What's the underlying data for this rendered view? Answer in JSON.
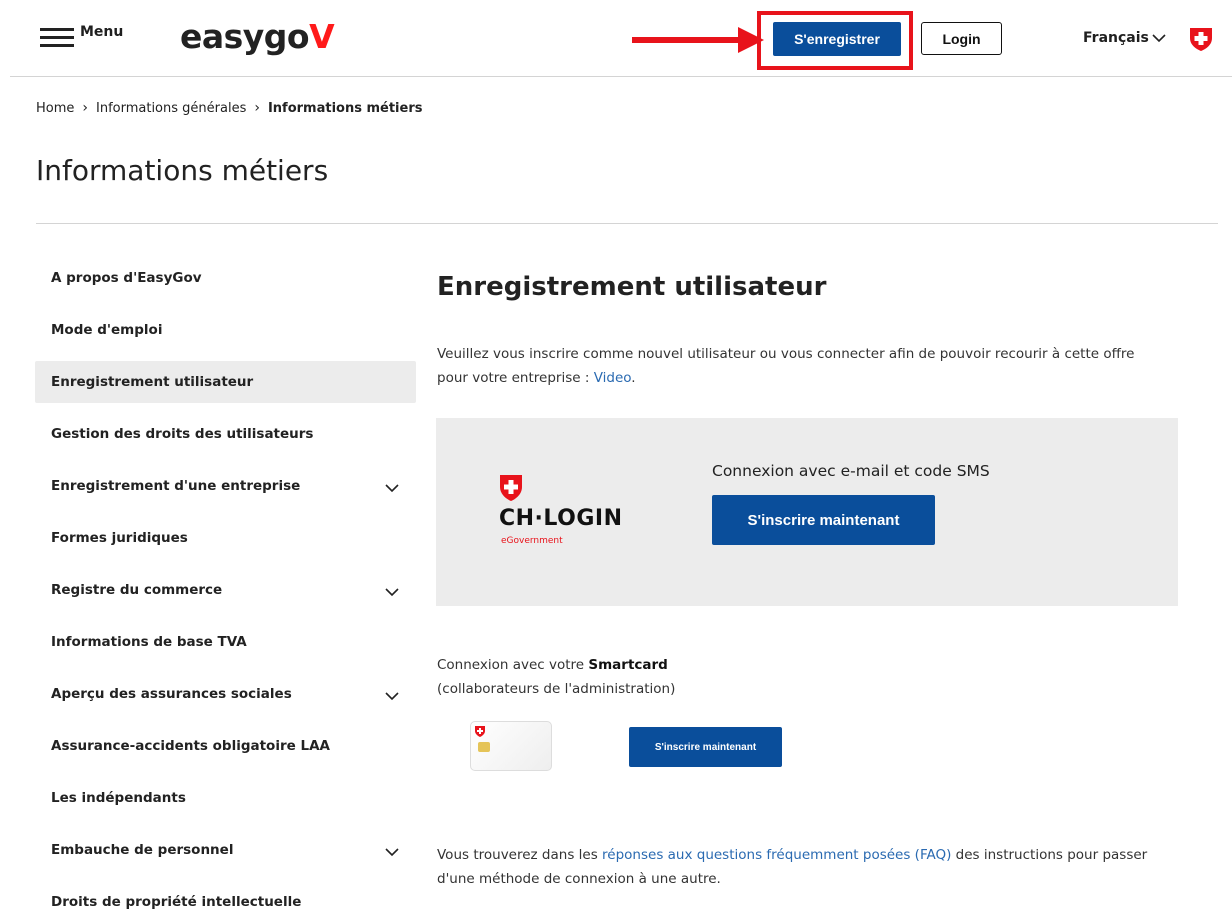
{
  "header": {
    "menu_label": "Menu",
    "logo_text": "easygo",
    "logo_accent": "V",
    "register_label": "S'enregistrer",
    "login_label": "Login",
    "language": "Français"
  },
  "breadcrumb": {
    "items": [
      "Home",
      "Informations générales",
      "Informations métiers"
    ]
  },
  "page_title": "Informations métiers",
  "sidebar": {
    "items": [
      {
        "label": "A propos d'EasyGov",
        "expandable": false,
        "active": false
      },
      {
        "label": "Mode d'emploi",
        "expandable": false,
        "active": false
      },
      {
        "label": "Enregistrement utilisateur",
        "expandable": false,
        "active": true
      },
      {
        "label": "Gestion des droits des utilisateurs",
        "expandable": false,
        "active": false
      },
      {
        "label": "Enregistrement d'une entreprise",
        "expandable": true,
        "active": false
      },
      {
        "label": "Formes juridiques",
        "expandable": false,
        "active": false
      },
      {
        "label": "Registre du commerce",
        "expandable": true,
        "active": false
      },
      {
        "label": "Informations de base TVA",
        "expandable": false,
        "active": false
      },
      {
        "label": "Aperçu des assurances sociales",
        "expandable": true,
        "active": false
      },
      {
        "label": "Assurance-accidents obligatoire LAA",
        "expandable": false,
        "active": false
      },
      {
        "label": "Les indépendants",
        "expandable": false,
        "active": false
      },
      {
        "label": "Embauche de personnel",
        "expandable": true,
        "active": false
      },
      {
        "label": "Droits de propriété intellectuelle",
        "expandable": false,
        "active": false
      }
    ]
  },
  "main": {
    "title": "Enregistrement utilisateur",
    "intro_text": "Veuillez vous inscrire comme nouvel utilisateur ou vous connecter afin de pouvoir recourir à cette offre pour votre entreprise : ",
    "intro_link": "Video",
    "intro_end": ".",
    "chlogin": {
      "logo_name": "CH·LOGIN",
      "logo_sub": "eGovernment",
      "description": "Connexion avec e-mail et code SMS",
      "button_label": "S'inscrire maintenant"
    },
    "smartcard": {
      "text_prefix": "Connexion avec votre ",
      "text_bold": "Smartcard",
      "text_line2": "(collaborateurs de l'administration)",
      "button_label": "S'inscrire maintenant"
    },
    "faq": {
      "prefix": "Vous trouverez dans les ",
      "link": "réponses aux questions fréquemment posées (FAQ)",
      "suffix": " des instructions pour passer d'une méthode de connexion à une autre."
    }
  },
  "colors": {
    "primary": "#0a4e9b",
    "accent_red": "#e8131b",
    "link": "#2a6ab1",
    "panel_bg": "#ececec"
  }
}
